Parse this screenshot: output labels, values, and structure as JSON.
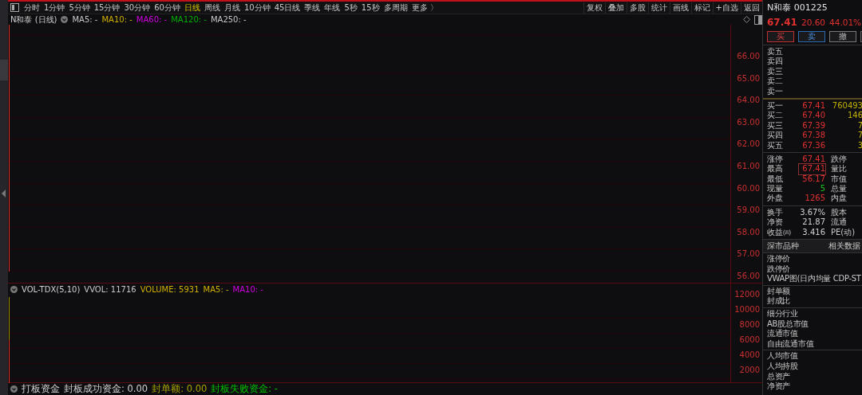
{
  "toolbar": {
    "periods": [
      {
        "label": "分时",
        "selected": false
      },
      {
        "label": "1分钟",
        "selected": false
      },
      {
        "label": "5分钟",
        "selected": false
      },
      {
        "label": "15分钟",
        "selected": false
      },
      {
        "label": "30分钟",
        "selected": false
      },
      {
        "label": "60分钟",
        "selected": false
      },
      {
        "label": "日线",
        "selected": true
      },
      {
        "label": "周线",
        "selected": false
      },
      {
        "label": "月线",
        "selected": false
      },
      {
        "label": "10分钟",
        "selected": false
      },
      {
        "label": "45日线",
        "selected": false
      },
      {
        "label": "季线",
        "selected": false
      },
      {
        "label": "年线",
        "selected": false
      },
      {
        "label": "5秒",
        "selected": false
      },
      {
        "label": "15秒",
        "selected": false
      },
      {
        "label": "多周期",
        "selected": false
      },
      {
        "label": "更多 〉",
        "selected": false
      }
    ],
    "tools": [
      "复权",
      "叠加",
      "多股",
      "统计",
      "画线",
      "标记",
      "+自选",
      "返回"
    ]
  },
  "price_chart": {
    "title": "N和泰 (日线)",
    "indicators": [
      {
        "label": "MA5: -",
        "color": "#c8c8c8"
      },
      {
        "label": "MA10: -",
        "color": "#d0b000"
      },
      {
        "label": "MA60: -",
        "color": "#d000e0"
      },
      {
        "label": "MA120: -",
        "color": "#00b000"
      },
      {
        "label": "MA250: -",
        "color": "#c8c8c8"
      }
    ],
    "axis_labels": [
      "66.00",
      "65.00",
      "64.00",
      "63.00",
      "62.00",
      "61.00",
      "60.00",
      "59.00",
      "58.00",
      "57.00",
      "56.00"
    ]
  },
  "volume_chart": {
    "title": "VOL-TDX(5,10)",
    "indicators": [
      {
        "label": "VVOL: 11716",
        "color": "#c8c8c8"
      },
      {
        "label": "VOLUME: 5931",
        "color": "#d0b000"
      },
      {
        "label": "MA5: -",
        "color": "#d0b000"
      },
      {
        "label": "MA10: -",
        "color": "#d000e0"
      }
    ],
    "axis_labels": [
      "12000",
      "10000",
      "8000",
      "6000",
      "4000",
      "2000"
    ]
  },
  "fund_bar": {
    "title": "打板资金",
    "indicators": [
      {
        "label": "封板成功资金: 0.00",
        "color": "#d0d0d0"
      },
      {
        "label": "封单额: 0.00",
        "color": "#a8a000"
      },
      {
        "label": "封板失败资金: -",
        "color": "#00c000"
      }
    ]
  },
  "quote": {
    "name": "N和泰 001225",
    "price": "67.41",
    "change": "20.60",
    "change_pct": "44.01%"
  },
  "order_buttons": [
    {
      "kind": "buy",
      "label": "买"
    },
    {
      "kind": "sell",
      "label": "卖"
    },
    {
      "kind": "cancel",
      "label": "撤"
    },
    {
      "kind": "blank"
    }
  ],
  "asks": [
    {
      "label": "卖五"
    },
    {
      "label": "卖四"
    },
    {
      "label": "卖三"
    },
    {
      "label": "卖二"
    },
    {
      "label": "卖一"
    }
  ],
  "bids": [
    {
      "label": "买一",
      "price": "67.41",
      "volume": "760493"
    },
    {
      "label": "买二",
      "price": "67.40",
      "volume": "146"
    },
    {
      "label": "买三",
      "price": "67.39",
      "volume": "7"
    },
    {
      "label": "买四",
      "price": "67.38",
      "volume": "7"
    },
    {
      "label": "买五",
      "price": "67.36",
      "volume": "3"
    }
  ],
  "stats": [
    {
      "label": "涨停",
      "value": "67.41",
      "color": "#e03030",
      "highlighted": false,
      "label_2": "跌停"
    },
    {
      "label": "最高",
      "value": "67.41",
      "color": "#e03030",
      "highlighted": true,
      "label_2": "量比"
    },
    {
      "label": "最低",
      "value": "56.17",
      "color": "#e03030",
      "highlighted": false,
      "label_2": "市值"
    },
    {
      "label": "现量",
      "value": "5",
      "color": "#20c020",
      "highlighted": false,
      "label_2": "总量"
    },
    {
      "label": "外盘",
      "value": "1265",
      "color": "#e03030",
      "highlighted": false,
      "label_2": "内盘"
    }
  ],
  "fundamentals": [
    {
      "label": "换手",
      "value": "3.67%",
      "label_2": "股本"
    },
    {
      "label": "净资",
      "value": "21.87",
      "label_2": "流通"
    },
    {
      "label": "收益㈣",
      "value": "3.416",
      "label_2": "PE(动)"
    }
  ],
  "info_tabs": [
    "深市品种",
    "相关数据"
  ],
  "info_groups": [
    [
      "涨停价",
      "跌停价",
      "VWAP图(日内均量 CDP-ST"
    ],
    [
      "封单额",
      "封成比"
    ],
    [
      "细分行业",
      "AB股总市值",
      "流通市值",
      "自由流通市值"
    ],
    [
      "人均市值",
      "人均持股",
      "总资产",
      "净资产"
    ]
  ]
}
